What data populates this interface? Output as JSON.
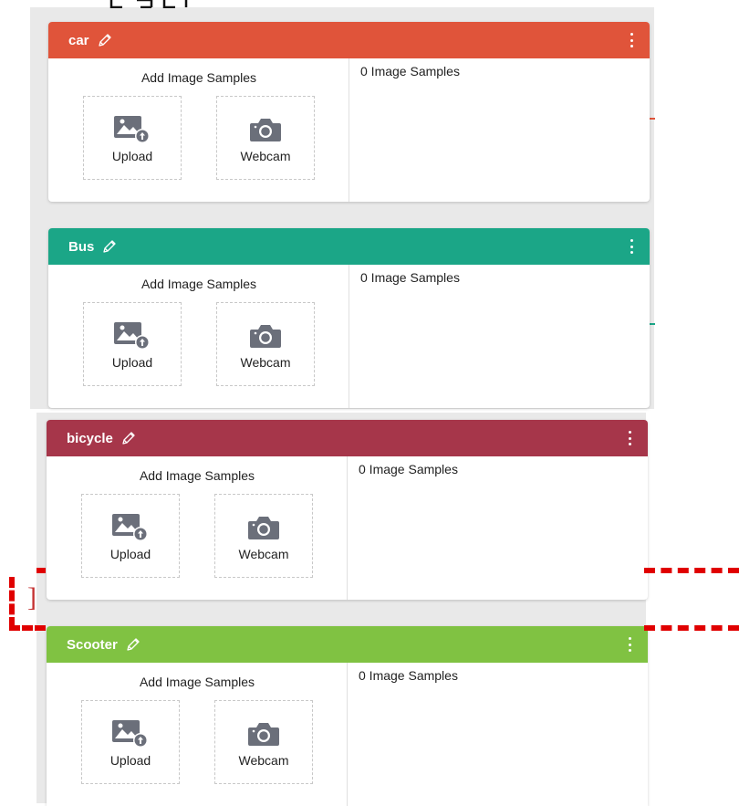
{
  "colors": {
    "car": "#e0543a",
    "bus": "#1ba687",
    "bicycle": "#a6364a",
    "scooter": "#80c242",
    "overlay_dash": "#e00000"
  },
  "overlay_stray_char": "]",
  "classes": [
    {
      "name": "car",
      "add_label": "Add Image Samples",
      "upload_label": "Upload",
      "webcam_label": "Webcam",
      "count_label": "0 Image Samples",
      "edit_icon": "pencil-icon",
      "menu_icon": "more-vertical-icon"
    },
    {
      "name": "Bus",
      "add_label": "Add Image Samples",
      "upload_label": "Upload",
      "webcam_label": "Webcam",
      "count_label": "0 Image Samples",
      "edit_icon": "pencil-icon",
      "menu_icon": "more-vertical-icon"
    },
    {
      "name": "bicycle",
      "add_label": "Add Image Samples",
      "upload_label": "Upload",
      "webcam_label": "Webcam",
      "count_label": "0 Image Samples",
      "edit_icon": "pencil-icon",
      "menu_icon": "more-vertical-icon"
    },
    {
      "name": "Scooter",
      "add_label": "Add Image Samples",
      "upload_label": "Upload",
      "webcam_label": "Webcam",
      "count_label": "0 Image Samples",
      "edit_icon": "pencil-icon",
      "menu_icon": "more-vertical-icon"
    }
  ]
}
